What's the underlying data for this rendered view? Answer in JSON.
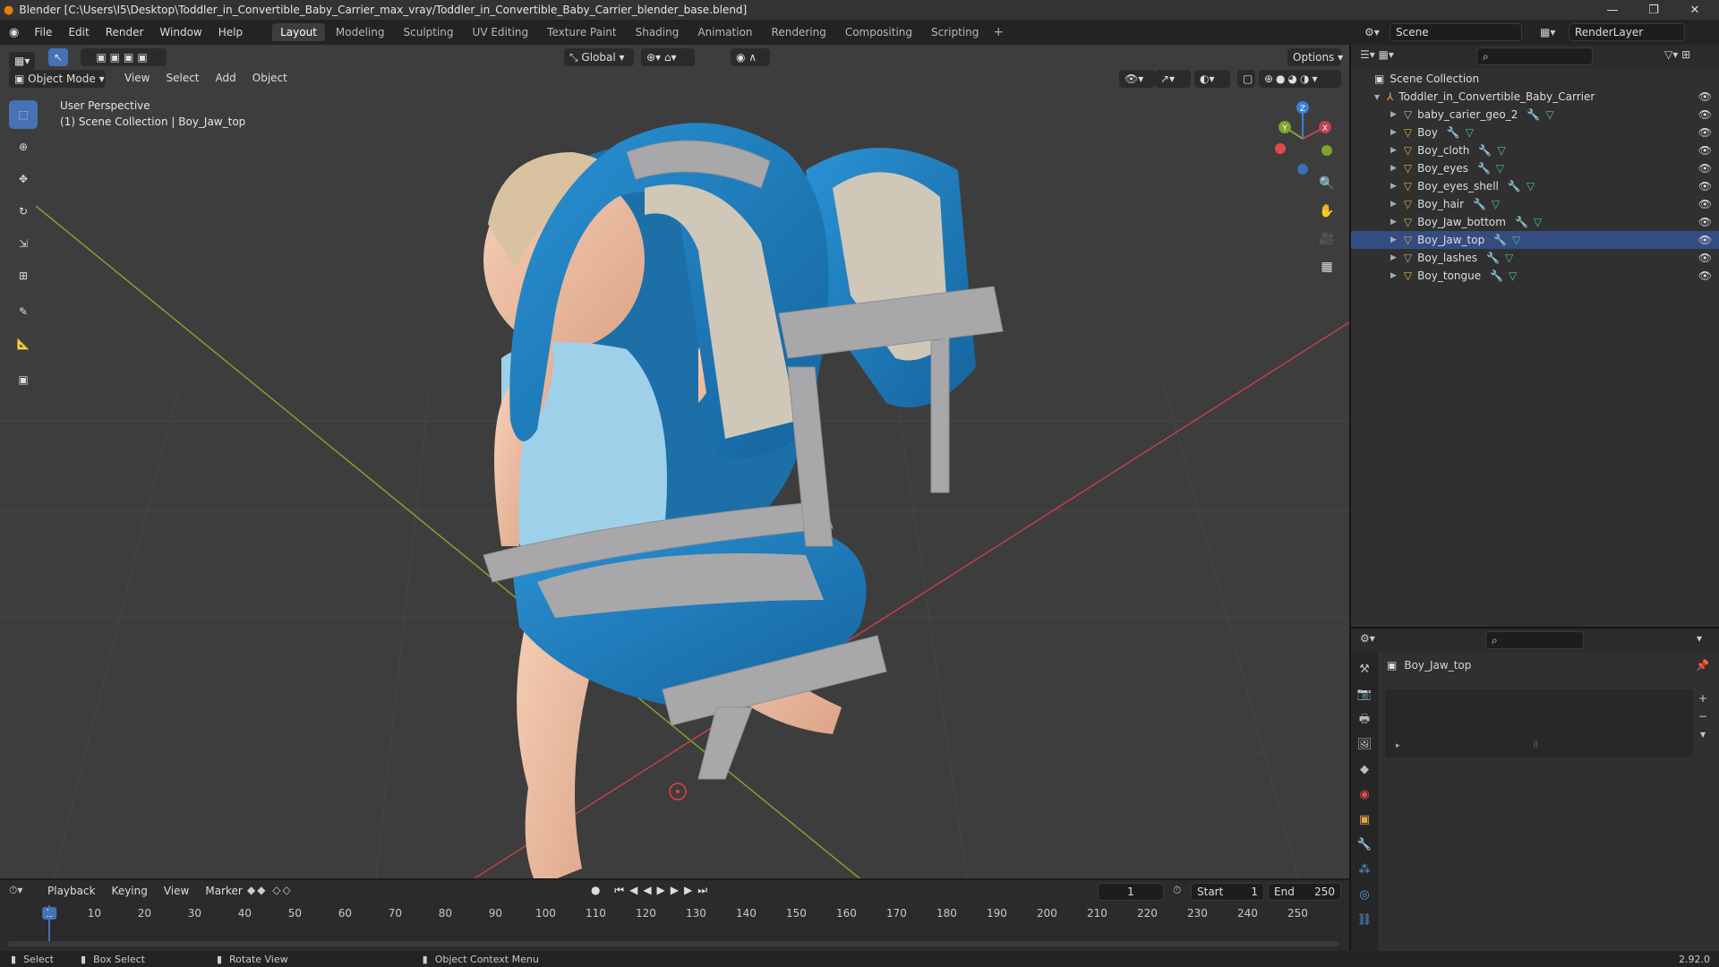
{
  "window": {
    "title": "Blender [C:\\Users\\I5\\Desktop\\Toddler_in_Convertible_Baby_Carrier_max_vray/Toddler_in_Convertible_Baby_Carrier_blender_base.blend]",
    "min": "—",
    "max": "❐",
    "close": "✕"
  },
  "menu": [
    "File",
    "Edit",
    "Render",
    "Window",
    "Help"
  ],
  "workspaces": [
    "Layout",
    "Modeling",
    "Sculpting",
    "UV Editing",
    "Texture Paint",
    "Shading",
    "Animation",
    "Rendering",
    "Compositing",
    "Scripting"
  ],
  "workspace_add": "+",
  "scene": {
    "label": "Scene",
    "layer": "RenderLayer"
  },
  "viewport": {
    "mode": "Object Mode",
    "menus": [
      "View",
      "Select",
      "Add",
      "Object"
    ],
    "orientation": "Global",
    "options": "Options",
    "info_line1": "User Perspective",
    "info_line2": "(1) Scene Collection | Boy_Jaw_top",
    "gizmo": {
      "z": "Z",
      "y": "Y",
      "x": "X"
    }
  },
  "tools": [
    "select-box",
    "cursor",
    "move",
    "rotate",
    "scale",
    "transform",
    "annotate",
    "measure",
    "add-cube"
  ],
  "outliner": {
    "root": "Scene Collection",
    "collection": "Toddler_in_Convertible_Baby_Carrier",
    "items": [
      "baby_carier_geo_2",
      "Boy",
      "Boy_cloth",
      "Boy_eyes",
      "Boy_eyes_shell",
      "Boy_hair",
      "Boy_Jaw_bottom",
      "Boy_Jaw_top",
      "Boy_lashes",
      "Boy_tongue"
    ],
    "active": "Boy_Jaw_top"
  },
  "properties": {
    "object": "Boy_Jaw_top"
  },
  "timeline": {
    "menus": [
      "Playback",
      "Keying",
      "View",
      "Marker"
    ],
    "current_frame": "1",
    "start_label": "Start",
    "start": "1",
    "end_label": "End",
    "end": "250",
    "ticks": [
      "1",
      "10",
      "20",
      "30",
      "40",
      "50",
      "60",
      "70",
      "80",
      "90",
      "100",
      "110",
      "120",
      "130",
      "140",
      "150",
      "160",
      "170",
      "180",
      "190",
      "200",
      "210",
      "220",
      "230",
      "240",
      "250"
    ]
  },
  "status": {
    "select": "Select",
    "box_select": "Box Select",
    "rotate": "Rotate View",
    "context": "Object Context Menu",
    "version": "2.92.0"
  },
  "colors": {
    "accent": "#4772b3",
    "carrier_blue": "#1f7fc2",
    "strap_gray": "#a8a8aa",
    "bodysuit": "#9fd0ea",
    "skin": "#f0c2a4",
    "x_axis": "#c2414a",
    "y_axis": "#7fa32c",
    "z_axis": "#3a7fd8"
  }
}
